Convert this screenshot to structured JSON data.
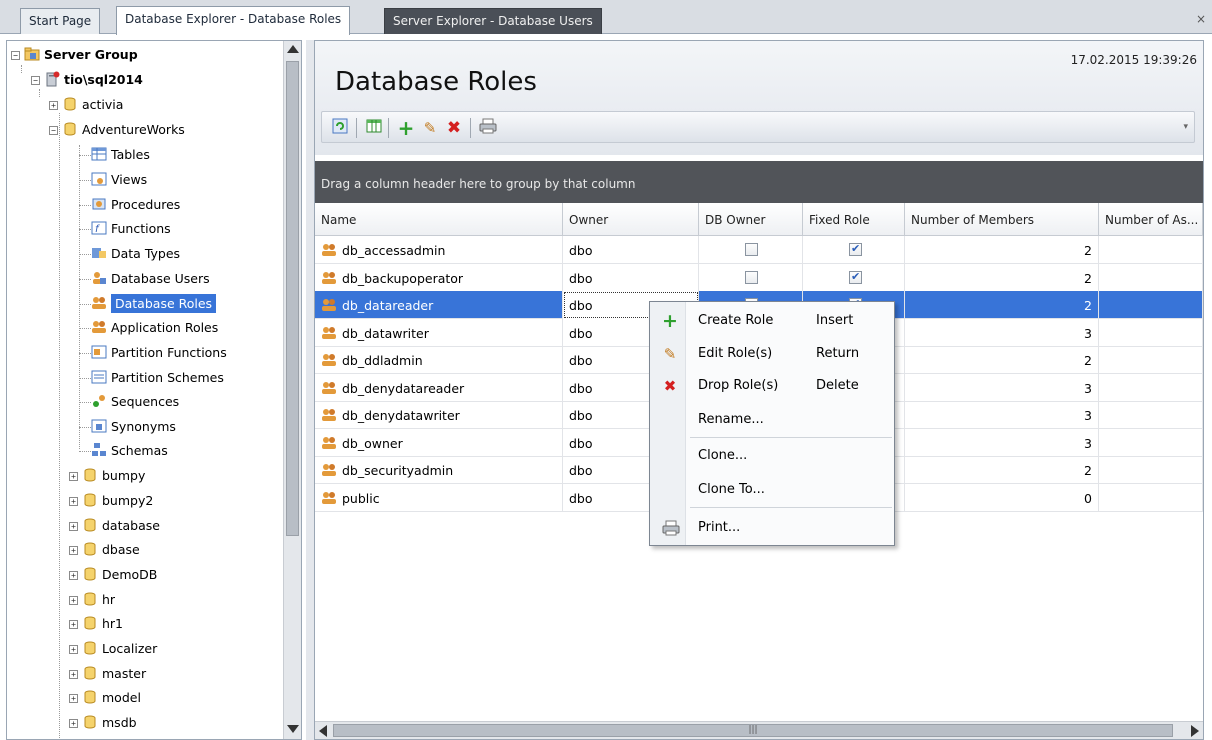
{
  "tabs": [
    {
      "label": "Start Page"
    },
    {
      "label": "Database Explorer - Database Roles"
    },
    {
      "label": "Server Explorer - Database Users"
    }
  ],
  "tab_close": "×",
  "tree": {
    "server_group": "Server Group",
    "server": "tio\\sql2014",
    "activia": "activia",
    "adventureworks": "AdventureWorks",
    "children": {
      "tables": "Tables",
      "views": "Views",
      "procedures": "Procedures",
      "functions": "Functions",
      "data_types": "Data Types",
      "database_users": "Database Users",
      "database_roles": "Database Roles",
      "application_roles": "Application Roles",
      "partition_functions": "Partition Functions",
      "partition_schemes": "Partition Schemes",
      "sequences": "Sequences",
      "synonyms": "Synonyms",
      "schemas": "Schemas"
    },
    "databases": [
      "bumpy",
      "bumpy2",
      "database",
      "dbase",
      "DemoDB",
      "hr",
      "hr1",
      "Localizer",
      "master",
      "model",
      "msdb"
    ]
  },
  "header": {
    "title": "Database Roles",
    "timestamp": "17.02.2015 19:39:26"
  },
  "group_hint": "Drag a column header here to group by that column",
  "grid": {
    "columns": [
      "Name",
      "Owner",
      "DB Owner",
      "Fixed Role",
      "Number of Members",
      "Number of As..."
    ],
    "rows": [
      {
        "name": "db_accessadmin",
        "owner": "dbo",
        "db_owner": false,
        "fixed": true,
        "members": "2"
      },
      {
        "name": "db_backupoperator",
        "owner": "dbo",
        "db_owner": false,
        "fixed": true,
        "members": "2"
      },
      {
        "name": "db_datareader",
        "owner": "dbo",
        "db_owner": false,
        "fixed": true,
        "members": "2"
      },
      {
        "name": "db_datawriter",
        "owner": "dbo",
        "db_owner": false,
        "fixed": true,
        "members": "3"
      },
      {
        "name": "db_ddladmin",
        "owner": "dbo",
        "db_owner": false,
        "fixed": true,
        "members": "2"
      },
      {
        "name": "db_denydatareader",
        "owner": "dbo",
        "db_owner": false,
        "fixed": true,
        "members": "3"
      },
      {
        "name": "db_denydatawriter",
        "owner": "dbo",
        "db_owner": false,
        "fixed": true,
        "members": "3"
      },
      {
        "name": "db_owner",
        "owner": "dbo",
        "db_owner": false,
        "fixed": true,
        "members": "3"
      },
      {
        "name": "db_securityadmin",
        "owner": "dbo",
        "db_owner": false,
        "fixed": true,
        "members": "2"
      },
      {
        "name": "public",
        "owner": "dbo",
        "db_owner": false,
        "fixed": false,
        "members": "0"
      }
    ]
  },
  "context_menu": {
    "create": {
      "label": "Create Role",
      "shortcut": "Insert"
    },
    "edit": {
      "label": "Edit Role(s)",
      "shortcut": "Return"
    },
    "drop": {
      "label": "Drop Role(s)",
      "shortcut": "Delete"
    },
    "rename": {
      "label": "Rename..."
    },
    "clone": {
      "label": "Clone..."
    },
    "clone_to": {
      "label": "Clone To..."
    },
    "print": {
      "label": "Print..."
    }
  },
  "colors": {
    "selection": "#3874d8",
    "group_bar": "#515459",
    "add_green": "#2ea02e",
    "delete_red": "#d42020"
  },
  "icons": {
    "refresh": "refresh-icon",
    "columns": "columns-icon",
    "add": "add-icon",
    "edit": "pencil-icon",
    "delete": "delete-icon",
    "print": "print-icon"
  }
}
